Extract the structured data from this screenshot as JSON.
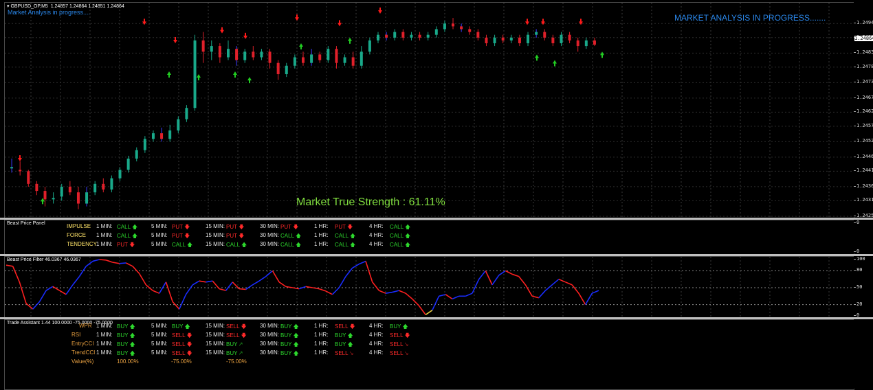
{
  "window": {
    "title": "GBPUSD_OP,M5",
    "ohlc": "1.24857 1.24864 1.24851 1.24864",
    "subtitle": "Market Analysis in progress....",
    "market_analysis": "MARKET ANALYSIS IN PROGRESS.......",
    "strength": "Market True Strength : 61.11%",
    "current_price": "1.24864"
  },
  "price_axis": [
    "1.24940",
    "1.24890",
    "1.24835",
    "1.24785",
    "1.24730",
    "1.24675",
    "1.24625",
    "1.24575",
    "1.24520",
    "1.24465",
    "1.24415",
    "1.24360",
    "1.24310",
    "1.24255"
  ],
  "price_range": [
    1.2425,
    1.2497
  ],
  "candles": [
    [
      1.24425,
      1.2443,
      1.2441,
      1.2446,
      "up"
    ],
    [
      1.2442,
      1.24415,
      1.244,
      1.2445,
      "down"
    ],
    [
      1.24415,
      1.2437,
      1.2436,
      1.2442,
      "down"
    ],
    [
      1.2437,
      1.24345,
      1.2433,
      1.2438,
      "down"
    ],
    [
      1.24345,
      1.24315,
      1.2429,
      1.2436,
      "down"
    ],
    [
      1.24315,
      1.2432,
      1.243,
      1.2434,
      "up"
    ],
    [
      1.24325,
      1.2436,
      1.2431,
      1.2437,
      "up"
    ],
    [
      1.2436,
      1.2434,
      1.2433,
      1.2438,
      "down"
    ],
    [
      1.2434,
      1.243,
      1.2428,
      1.2436,
      "down"
    ],
    [
      1.243,
      1.2434,
      1.2429,
      1.2436,
      "up"
    ],
    [
      1.2434,
      1.2437,
      1.2433,
      1.2438,
      "up"
    ],
    [
      1.2437,
      1.2435,
      1.2434,
      1.2439,
      "down"
    ],
    [
      1.2435,
      1.2439,
      1.2434,
      1.244,
      "up"
    ],
    [
      1.2439,
      1.2442,
      1.2438,
      1.2443,
      "up"
    ],
    [
      1.2442,
      1.2446,
      1.2441,
      1.2447,
      "up"
    ],
    [
      1.2446,
      1.2449,
      1.2445,
      1.245,
      "up"
    ],
    [
      1.2449,
      1.2453,
      1.2448,
      1.2454,
      "up"
    ],
    [
      1.2453,
      1.2455,
      1.2452,
      1.2456,
      "up"
    ],
    [
      1.2455,
      1.2453,
      1.2452,
      1.2457,
      "down"
    ],
    [
      1.2453,
      1.2456,
      1.2452,
      1.2458,
      "up"
    ],
    [
      1.2456,
      1.246,
      1.2455,
      1.2461,
      "up"
    ],
    [
      1.246,
      1.2464,
      1.2459,
      1.2465,
      "up"
    ],
    [
      1.2464,
      1.2488,
      1.2463,
      1.249,
      "up"
    ],
    [
      1.2488,
      1.2484,
      1.248,
      1.2491,
      "down"
    ],
    [
      1.2484,
      1.2486,
      1.2481,
      1.2488,
      "up"
    ],
    [
      1.2486,
      1.2482,
      1.248,
      1.2487,
      "down"
    ],
    [
      1.2482,
      1.2485,
      1.2481,
      1.2488,
      "up"
    ],
    [
      1.2485,
      1.2481,
      1.2479,
      1.2486,
      "down"
    ],
    [
      1.2481,
      1.2484,
      1.248,
      1.2485,
      "up"
    ],
    [
      1.2484,
      1.2482,
      1.2481,
      1.2486,
      "down"
    ],
    [
      1.2482,
      1.2484,
      1.2481,
      1.2485,
      "up"
    ],
    [
      1.2484,
      1.248,
      1.2478,
      1.2485,
      "down"
    ],
    [
      1.248,
      1.2476,
      1.2474,
      1.2481,
      "down"
    ],
    [
      1.2476,
      1.2479,
      1.2475,
      1.248,
      "up"
    ],
    [
      1.2479,
      1.2482,
      1.2478,
      1.2483,
      "up"
    ],
    [
      1.2482,
      1.248,
      1.2479,
      1.2484,
      "down"
    ],
    [
      1.248,
      1.2483,
      1.2479,
      1.2485,
      "up"
    ],
    [
      1.2483,
      1.2481,
      1.248,
      1.2484,
      "down"
    ],
    [
      1.2481,
      1.2485,
      1.248,
      1.2486,
      "up"
    ],
    [
      1.2485,
      1.248,
      1.2478,
      1.2486,
      "down"
    ],
    [
      1.248,
      1.2482,
      1.2479,
      1.2483,
      "up"
    ],
    [
      1.2482,
      1.2479,
      1.2478,
      1.2484,
      "down"
    ],
    [
      1.2479,
      1.2484,
      1.2478,
      1.2486,
      "up"
    ],
    [
      1.2484,
      1.2488,
      1.2483,
      1.2489,
      "up"
    ],
    [
      1.2488,
      1.249,
      1.2487,
      1.2491,
      "up"
    ],
    [
      1.249,
      1.2489,
      1.2488,
      1.2491,
      "down"
    ],
    [
      1.2489,
      1.2491,
      1.2488,
      1.2492,
      "up"
    ],
    [
      1.2491,
      1.2489,
      1.2488,
      1.2492,
      "down"
    ],
    [
      1.2489,
      1.249,
      1.2488,
      1.2491,
      "up"
    ],
    [
      1.249,
      1.2489,
      1.2488,
      1.2491,
      "down"
    ],
    [
      1.2489,
      1.249,
      1.2488,
      1.2491,
      "up"
    ],
    [
      1.249,
      1.2492,
      1.2489,
      1.2493,
      "up"
    ],
    [
      1.2492,
      1.2494,
      1.2491,
      1.2495,
      "up"
    ],
    [
      1.2494,
      1.2493,
      1.2492,
      1.2496,
      "down"
    ],
    [
      1.2493,
      1.2492,
      1.2491,
      1.2494,
      "down"
    ],
    [
      1.2492,
      1.2491,
      1.249,
      1.2493,
      "down"
    ],
    [
      1.2491,
      1.2489,
      1.2488,
      1.2492,
      "down"
    ],
    [
      1.2489,
      1.2487,
      1.2486,
      1.249,
      "down"
    ],
    [
      1.2487,
      1.2489,
      1.2486,
      1.249,
      "up"
    ],
    [
      1.2489,
      1.2488,
      1.2487,
      1.249,
      "down"
    ],
    [
      1.2488,
      1.2489,
      1.2487,
      1.249,
      "up"
    ],
    [
      1.2489,
      1.2487,
      1.2486,
      1.249,
      "down"
    ],
    [
      1.2487,
      1.249,
      1.2486,
      1.2491,
      "up"
    ],
    [
      1.249,
      1.2491,
      1.2489,
      1.2492,
      "up"
    ],
    [
      1.2491,
      1.2489,
      1.2488,
      1.2492,
      "down"
    ],
    [
      1.2489,
      1.2487,
      1.2486,
      1.249,
      "down"
    ],
    [
      1.2487,
      1.249,
      1.2486,
      1.2491,
      "up"
    ],
    [
      1.249,
      1.2488,
      1.2487,
      1.2491,
      "down"
    ],
    [
      1.2488,
      1.2486,
      1.2484,
      1.2489,
      "down"
    ],
    [
      1.2486,
      1.2488,
      1.2485,
      1.2489,
      "up"
    ],
    [
      1.2488,
      1.24865,
      1.2486,
      1.2489,
      "down"
    ]
  ],
  "arrows_down": [
    [
      22,
      1.2445
    ],
    [
      203,
      1.24935
    ],
    [
      248,
      1.2487
    ],
    [
      316,
      1.24905
    ],
    [
      350,
      1.24885
    ],
    [
      425,
      1.2495
    ],
    [
      487,
      1.2493
    ],
    [
      546,
      1.24975
    ],
    [
      760,
      1.24935
    ],
    [
      783,
      1.24935
    ],
    [
      838,
      1.24935
    ]
  ],
  "arrows_up": [
    [
      55,
      1.2432
    ],
    [
      239,
      1.2477
    ],
    [
      282,
      1.2476
    ],
    [
      335,
      1.2477
    ],
    [
      356,
      1.2475
    ],
    [
      431,
      1.2487
    ],
    [
      502,
      1.2489
    ],
    [
      774,
      1.2483
    ],
    [
      800,
      1.2481
    ],
    [
      869,
      1.2484
    ]
  ],
  "panel": {
    "title": "Beast Price Panel",
    "axis_top": "0",
    "axis_bottom": "0",
    "rows": [
      {
        "label": "IMPULSE",
        "cells": [
          [
            "1 MIN:",
            "CALL",
            "call"
          ],
          [
            "5 MIN:",
            "PUT",
            "put"
          ],
          [
            "15 MIN:",
            "PUT",
            "put"
          ],
          [
            "30 MIN:",
            "PUT",
            "put"
          ],
          [
            "1 HR:",
            "PUT",
            "put"
          ],
          [
            "4 HR:",
            "CALL",
            "call"
          ]
        ]
      },
      {
        "label": "FORCE",
        "cells": [
          [
            "1 MIN:",
            "CALL",
            "call"
          ],
          [
            "5 MIN:",
            "PUT",
            "put"
          ],
          [
            "15 MIN:",
            "PUT",
            "put"
          ],
          [
            "30 MIN:",
            "CALL",
            "call"
          ],
          [
            "1 HR:",
            "CALL",
            "call"
          ],
          [
            "4 HR:",
            "CALL",
            "call"
          ]
        ]
      },
      {
        "label": "TENDENCY",
        "cells": [
          [
            "1 MIN:",
            "PUT",
            "put"
          ],
          [
            "5 MIN:",
            "CALL",
            "call"
          ],
          [
            "15 MIN:",
            "CALL",
            "call"
          ],
          [
            "30 MIN:",
            "CALL",
            "call"
          ],
          [
            "1 HR:",
            "CALL",
            "call"
          ],
          [
            "4 HR:",
            "CALL",
            "call"
          ]
        ]
      }
    ]
  },
  "filter": {
    "title": "Beast Price Filter 46.0367 46.0367",
    "axis": [
      "100",
      "80",
      "50",
      "20",
      "0"
    ],
    "levels": [
      80,
      50,
      20
    ],
    "values": [
      90,
      88,
      60,
      22,
      12,
      25,
      45,
      52,
      45,
      38,
      55,
      70,
      88,
      97,
      100,
      99,
      95,
      93,
      94,
      88,
      75,
      55,
      45,
      40,
      60,
      25,
      12,
      38,
      55,
      62,
      60,
      62,
      48,
      45,
      60,
      48,
      47,
      55,
      62,
      70,
      80,
      60,
      52,
      50,
      48,
      52,
      50,
      48,
      44,
      38,
      50,
      70,
      85,
      92,
      97,
      60,
      45,
      40,
      42,
      45,
      40,
      30,
      18,
      2,
      10,
      35,
      38,
      30,
      35,
      35,
      40,
      65,
      80,
      55,
      72,
      80,
      74,
      70,
      55,
      35,
      32,
      45,
      55,
      65,
      60,
      55,
      40,
      20,
      40,
      45
    ]
  },
  "trade": {
    "title": "Trade Assistant 1.44  100.0000 -75.0000 -75.0000",
    "rows": [
      {
        "label": "WPR",
        "color": "orange",
        "cells": [
          [
            "1 MIN:",
            "BUY",
            "call",
            "up"
          ],
          [
            "5 MIN:",
            "BUY",
            "call",
            "up"
          ],
          [
            "15 MIN:",
            "SELL",
            "put",
            "down"
          ],
          [
            "30 MIN:",
            "BUY",
            "call",
            "up"
          ],
          [
            "1 HR:",
            "SELL",
            "put",
            "down"
          ],
          [
            "4 HR:",
            "BUY",
            "call",
            "up"
          ]
        ]
      },
      {
        "label": "RSI",
        "color": "orange",
        "cells": [
          [
            "1 MIN:",
            "BUY",
            "call",
            "up"
          ],
          [
            "5 MIN:",
            "SELL",
            "put",
            "down"
          ],
          [
            "15 MIN:",
            "SELL",
            "put",
            "down"
          ],
          [
            "30 MIN:",
            "BUY",
            "call",
            "up"
          ],
          [
            "1 HR:",
            "BUY",
            "call",
            "up"
          ],
          [
            "4 HR:",
            "SELL",
            "put",
            "down"
          ]
        ]
      },
      {
        "label": "EntryCCI",
        "color": "orange",
        "cells": [
          [
            "1 MIN:",
            "BUY",
            "call",
            "up"
          ],
          [
            "5 MIN:",
            "SELL",
            "put",
            "down"
          ],
          [
            "15 MIN:",
            "BUY",
            "call",
            "upright"
          ],
          [
            "30 MIN:",
            "BUY",
            "call",
            "up"
          ],
          [
            "1 HR:",
            "BUY",
            "call",
            "up"
          ],
          [
            "4 HR:",
            "SELL",
            "put",
            "downright"
          ]
        ]
      },
      {
        "label": "TrendCCI",
        "color": "orange",
        "cells": [
          [
            "1 MIN:",
            "BUY",
            "call",
            "up"
          ],
          [
            "5 MIN:",
            "SELL",
            "put",
            "down"
          ],
          [
            "15 MIN:",
            "BUY",
            "call",
            "upright"
          ],
          [
            "30 MIN:",
            "BUY",
            "call",
            "up"
          ],
          [
            "1 HR:",
            "SELL",
            "put",
            "downright"
          ],
          [
            "4 HR:",
            "SELL",
            "put",
            "downright"
          ]
        ]
      }
    ],
    "value_label": "Value(%)",
    "values": [
      "100.00%",
      "-75.00%",
      "-75.00%"
    ]
  }
}
